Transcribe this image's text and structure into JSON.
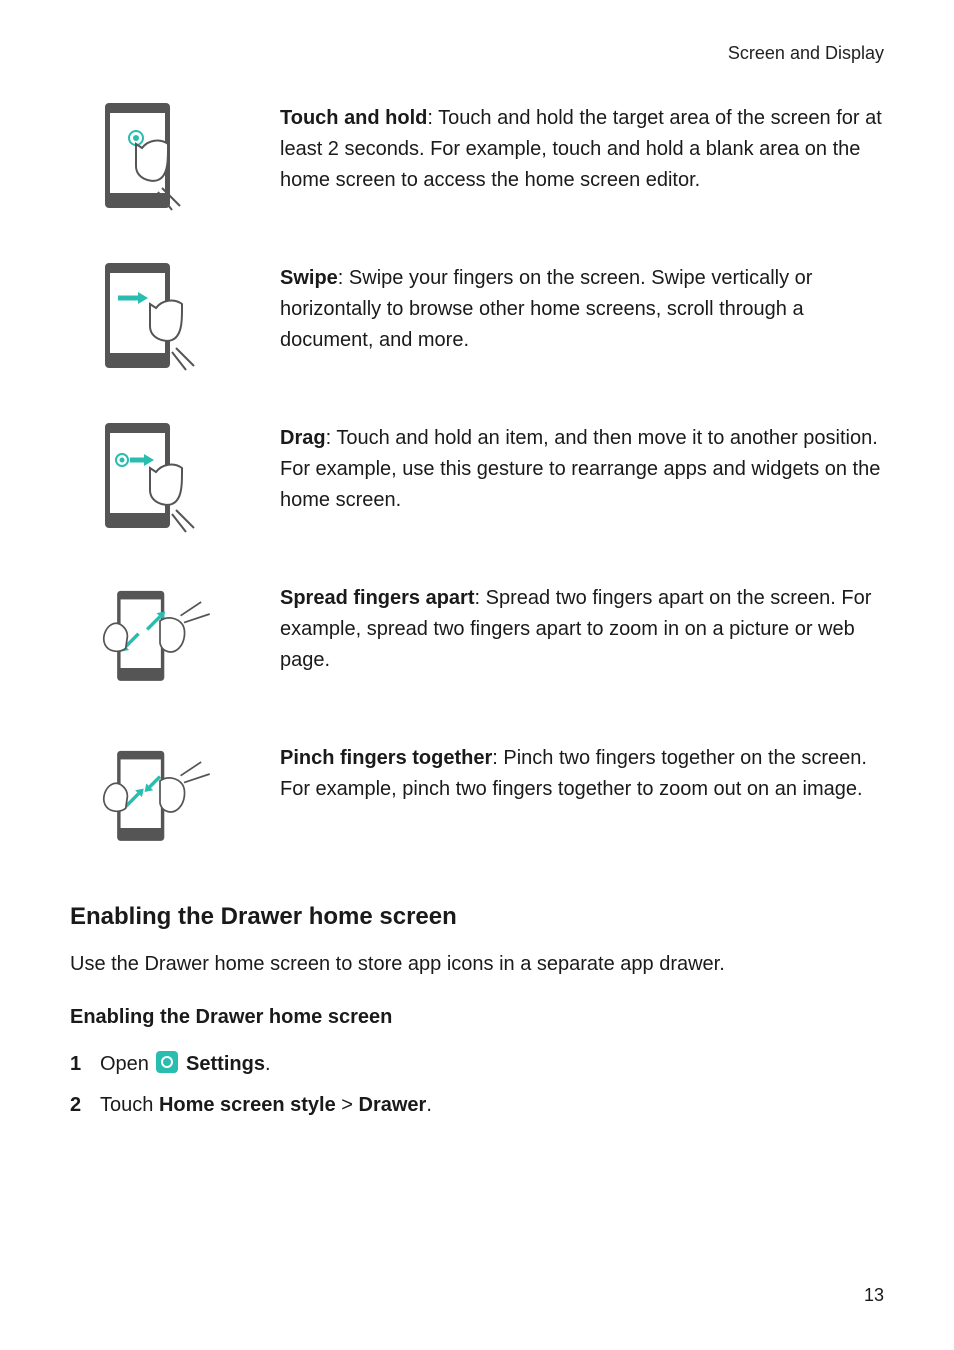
{
  "header": "Screen and Display",
  "gestures": [
    {
      "title": "Touch and hold",
      "body": ": Touch and hold the target area of the screen for at least 2 seconds. For example, touch and hold a blank area on the home screen to access the home screen editor."
    },
    {
      "title": "Swipe",
      "body": ": Swipe your fingers on the screen. Swipe vertically or horizontally to browse other home screens, scroll through a document, and more."
    },
    {
      "title": "Drag",
      "body": ": Touch and hold an item, and then move it to another position. For example, use this gesture to rearrange apps and widgets on the home screen."
    },
    {
      "title": "Spread fingers apart",
      "body": ": Spread two fingers apart on the screen. For example, spread two fingers apart to zoom in on a picture or web page."
    },
    {
      "title": "Pinch fingers together",
      "body": ": Pinch two fingers together on the screen. For example, pinch two fingers together to zoom out on an image."
    }
  ],
  "section_title": "Enabling the Drawer home screen",
  "section_intro": "Use the Drawer home screen to store app icons in a separate app drawer.",
  "sub_title": "Enabling the Drawer home screen",
  "step1": {
    "pre": "Open ",
    "post": " ",
    "bold": "Settings",
    "end": "."
  },
  "step2": {
    "pre": "Touch ",
    "b1": "Home screen style",
    "sep": " > ",
    "b2": "Drawer",
    "end": "."
  },
  "page_number": "13"
}
